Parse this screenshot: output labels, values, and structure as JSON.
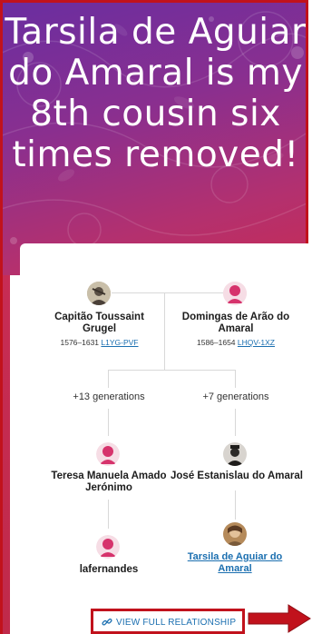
{
  "hero": {
    "title": "Tarsila de Aguiar do Amaral is my 8th cousin six times removed!"
  },
  "ancestors": {
    "left": {
      "name": "Capitão Toussaint Grugel",
      "years": "1576–1631",
      "id": "L1YG-PVF"
    },
    "right": {
      "name": "Domingas de Arão do Amaral",
      "years": "1586–1654",
      "id": "LHQV-1XZ"
    }
  },
  "generations": {
    "left": "+13 generations",
    "right": "+7 generations"
  },
  "branch_left": {
    "person1": "Teresa Manuela Amado Jerónimo",
    "person2": "lafernandes"
  },
  "branch_right": {
    "person1": "José Estanislau do Amaral",
    "person2": "Tarsila de Aguiar do Amaral"
  },
  "cta": {
    "label": "VIEW FULL RELATIONSHIP"
  },
  "colors": {
    "accent_red": "#c1121c",
    "link_blue": "#1b6fb0",
    "female_avatar": "#d6336c",
    "hero_purple": "#6a2ea0",
    "hero_pink": "#c72c55"
  },
  "icons": {
    "cta_icon": "link-chain-icon",
    "annotation": "right-arrow-icon"
  }
}
